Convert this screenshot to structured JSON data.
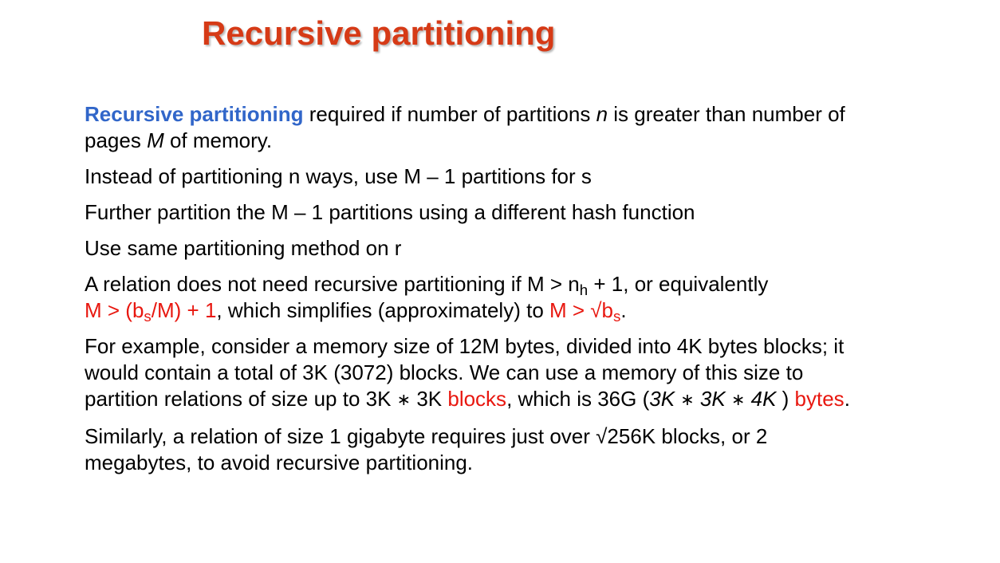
{
  "slide": {
    "title": "Recursive partitioning"
  },
  "colors": {
    "title": "#d63a16",
    "highlight_blue": "#3166c9",
    "highlight_red": "#e8170f",
    "body_text": "#000000"
  },
  "p1": {
    "term": "Recursive partitioning",
    "t1": " required if number of partitions ",
    "n": "n",
    "t2": " is greater than number of pages ",
    "m": "M",
    "t3": " of memory."
  },
  "p2": {
    "text": "Instead of partitioning n ways, use  M – 1 partitions for s"
  },
  "p3": {
    "text": "Further partition the M – 1 partitions using a different hash function"
  },
  "p4": {
    "text": "Use same partitioning method on r"
  },
  "p5": {
    "t1": "A relation does not need recursive partitioning if M > n",
    "sub_h": "h",
    "t2": " + 1, or equivalently",
    "red1a": "M > (b",
    "sub_s1": "s",
    "red1b": "/M) + 1",
    "t3": ", which simplifies (approximately) to ",
    "red2a": "M > √b",
    "sub_s2": "s",
    "t4": "."
  },
  "p6": {
    "t1": "For example, consider a memory size of 12M bytes, divided into 4K bytes blocks; it would contain a total of 3K (3072) blocks. We can use a memory of this size to partition relations of size up to 3K ",
    "op1": "∗",
    "t2": " 3K ",
    "red_blocks": "blocks",
    "t3": ", which is 36G (",
    "i1": "3K ",
    "op2": "∗",
    "i2": " 3K ",
    "op3": "∗",
    "i3": " 4K",
    "t4": " ) ",
    "red_bytes": "bytes",
    "t5": "."
  },
  "p7": {
    "text": "Similarly, a relation of size 1 gigabyte requires just over √256K blocks, or 2 megabytes, to avoid recursive partitioning."
  }
}
